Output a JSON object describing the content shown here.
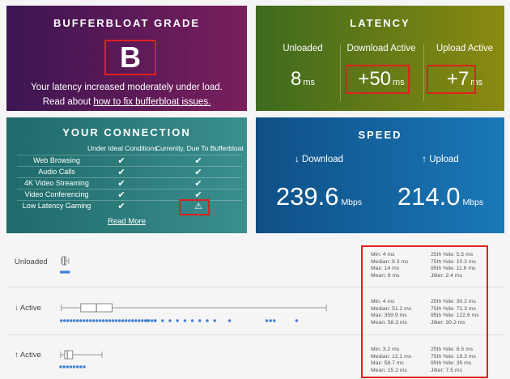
{
  "grade_card": {
    "title": "BUFFERBLOAT GRADE",
    "grade": "B",
    "description": "Your latency increased moderately under load.",
    "link_prefix": "Read about ",
    "link_text": "how to fix bufferbloat issues."
  },
  "latency_card": {
    "title": "LATENCY",
    "columns": [
      {
        "label": "Unloaded",
        "value": "8",
        "unit": "ms"
      },
      {
        "label": "Download Active",
        "value": "+50",
        "unit": "ms"
      },
      {
        "label": "Upload Active",
        "value": "+7",
        "unit": "ms"
      }
    ]
  },
  "connection_card": {
    "title": "YOUR CONNECTION",
    "headers": [
      "Under Ideal Conditions",
      "Currently, Due To Bufferbloat"
    ],
    "rows": [
      {
        "name": "Web Browsing",
        "ideal": "✔",
        "current": "✔"
      },
      {
        "name": "Audio Calls",
        "ideal": "✔",
        "current": "✔"
      },
      {
        "name": "4K Video Streaming",
        "ideal": "✔",
        "current": "✔"
      },
      {
        "name": "Video Conferencing",
        "ideal": "✔",
        "current": "✔"
      },
      {
        "name": "Low Latency Gaming",
        "ideal": "✔",
        "current": "⚠"
      }
    ],
    "read_more": "Read More"
  },
  "speed_card": {
    "title": "SPEED",
    "download_label": "↓ Download",
    "download_value": "239.6",
    "upload_label": "↑ Upload",
    "upload_value": "214.0",
    "unit": "Mbps"
  },
  "stats_rows": [
    {
      "label": "Unloaded",
      "left": [
        "Min: 4 ms",
        "Median: 8.3 ms",
        "Max: 14 ms",
        "Mean: 8 ms"
      ],
      "right": [
        "25th %ile: 5.5 ms",
        "75th %ile: 10.2 ms",
        "95th %ile: 11.6 ms",
        "Jitter: 2.4 ms"
      ]
    },
    {
      "label": "↓ Active",
      "left": [
        "Min: 4 ms",
        "Median: 51.2 ms",
        "Max: 359.9 ms",
        "Mean: 58.3 ms"
      ],
      "right": [
        "25th %ile: 30.2 ms",
        "75th %ile: 72.3 ms",
        "95th %ile: 122.6 ms",
        "Jitter: 30.2 ms"
      ]
    },
    {
      "label": "↑ Active",
      "left": [
        "Min: 3.2 ms",
        "Median: 12.1 ms",
        "Max: 58.7 ms",
        "Mean: 15.2 ms"
      ],
      "right": [
        "25th %ile: 8.5 ms",
        "75th %ile: 19.3 ms",
        "95th %ile: 35 ms",
        "Jitter: 7.5 ms"
      ]
    }
  ],
  "box_plots": [
    {
      "min": 4,
      "q1": 5.5,
      "median": 8.3,
      "q3": 10.2,
      "max": 14
    },
    {
      "min": 4,
      "q1": 30.2,
      "median": 51.2,
      "q3": 72.3,
      "max": 359.9,
      "outliers": [
        120,
        130,
        140,
        150,
        160,
        170,
        180,
        190,
        200,
        210,
        230,
        280,
        285,
        290,
        320
      ]
    },
    {
      "min": 3.2,
      "q1": 8.5,
      "median": 12.1,
      "q3": 19.3,
      "max": 58.7
    }
  ],
  "colors": {
    "highlight": "#e02020",
    "dot": "#3f7fd6"
  }
}
